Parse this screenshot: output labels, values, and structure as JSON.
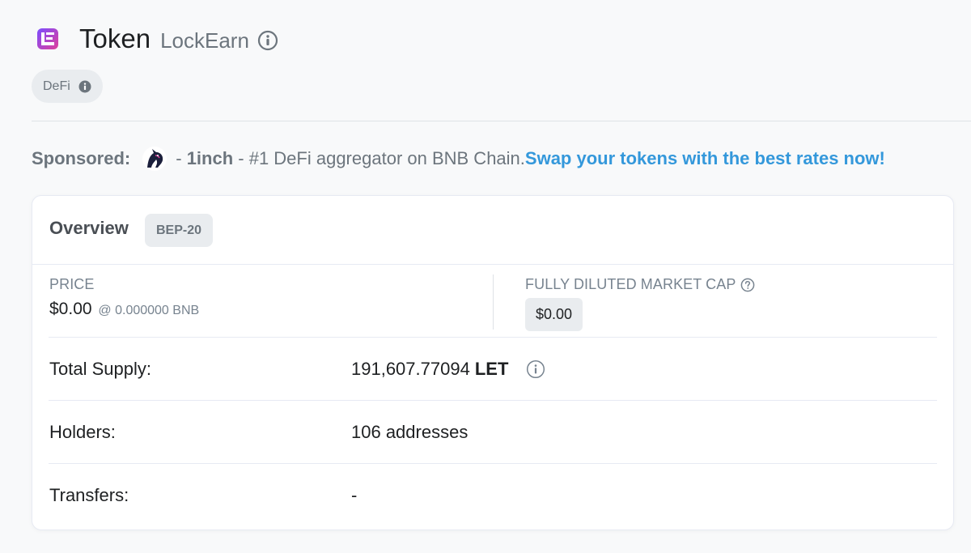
{
  "header": {
    "title": "Token",
    "token_name": "LockEarn",
    "logo_icon": "lockearn-logo-icon",
    "tag": "DeFi"
  },
  "sponsored": {
    "label": "Sponsored:",
    "brand_icon": "1inch-unicorn-icon",
    "text_prefix": "- ",
    "brand": "1inch",
    "text_middle": " - #1 DeFi aggregator on BNB Chain.",
    "link": "Swap your tokens with the best rates now!"
  },
  "overview": {
    "title": "Overview",
    "badge": "BEP-20",
    "price_label": "PRICE",
    "price_value": "$0.00",
    "price_bnb": "@ 0.000000 BNB",
    "mcap_label": "FULLY DILUTED MARKET CAP",
    "mcap_value": "$0.00",
    "total_supply_label": "Total Supply:",
    "total_supply_value": "191,607.77094",
    "total_supply_symbol": "LET",
    "holders_label": "Holders:",
    "holders_value": "106 addresses",
    "transfers_label": "Transfers:",
    "transfers_value": "-"
  },
  "colors": {
    "accent_link": "#3498db",
    "muted": "#6c757d",
    "badge_bg": "#e9ecef"
  }
}
